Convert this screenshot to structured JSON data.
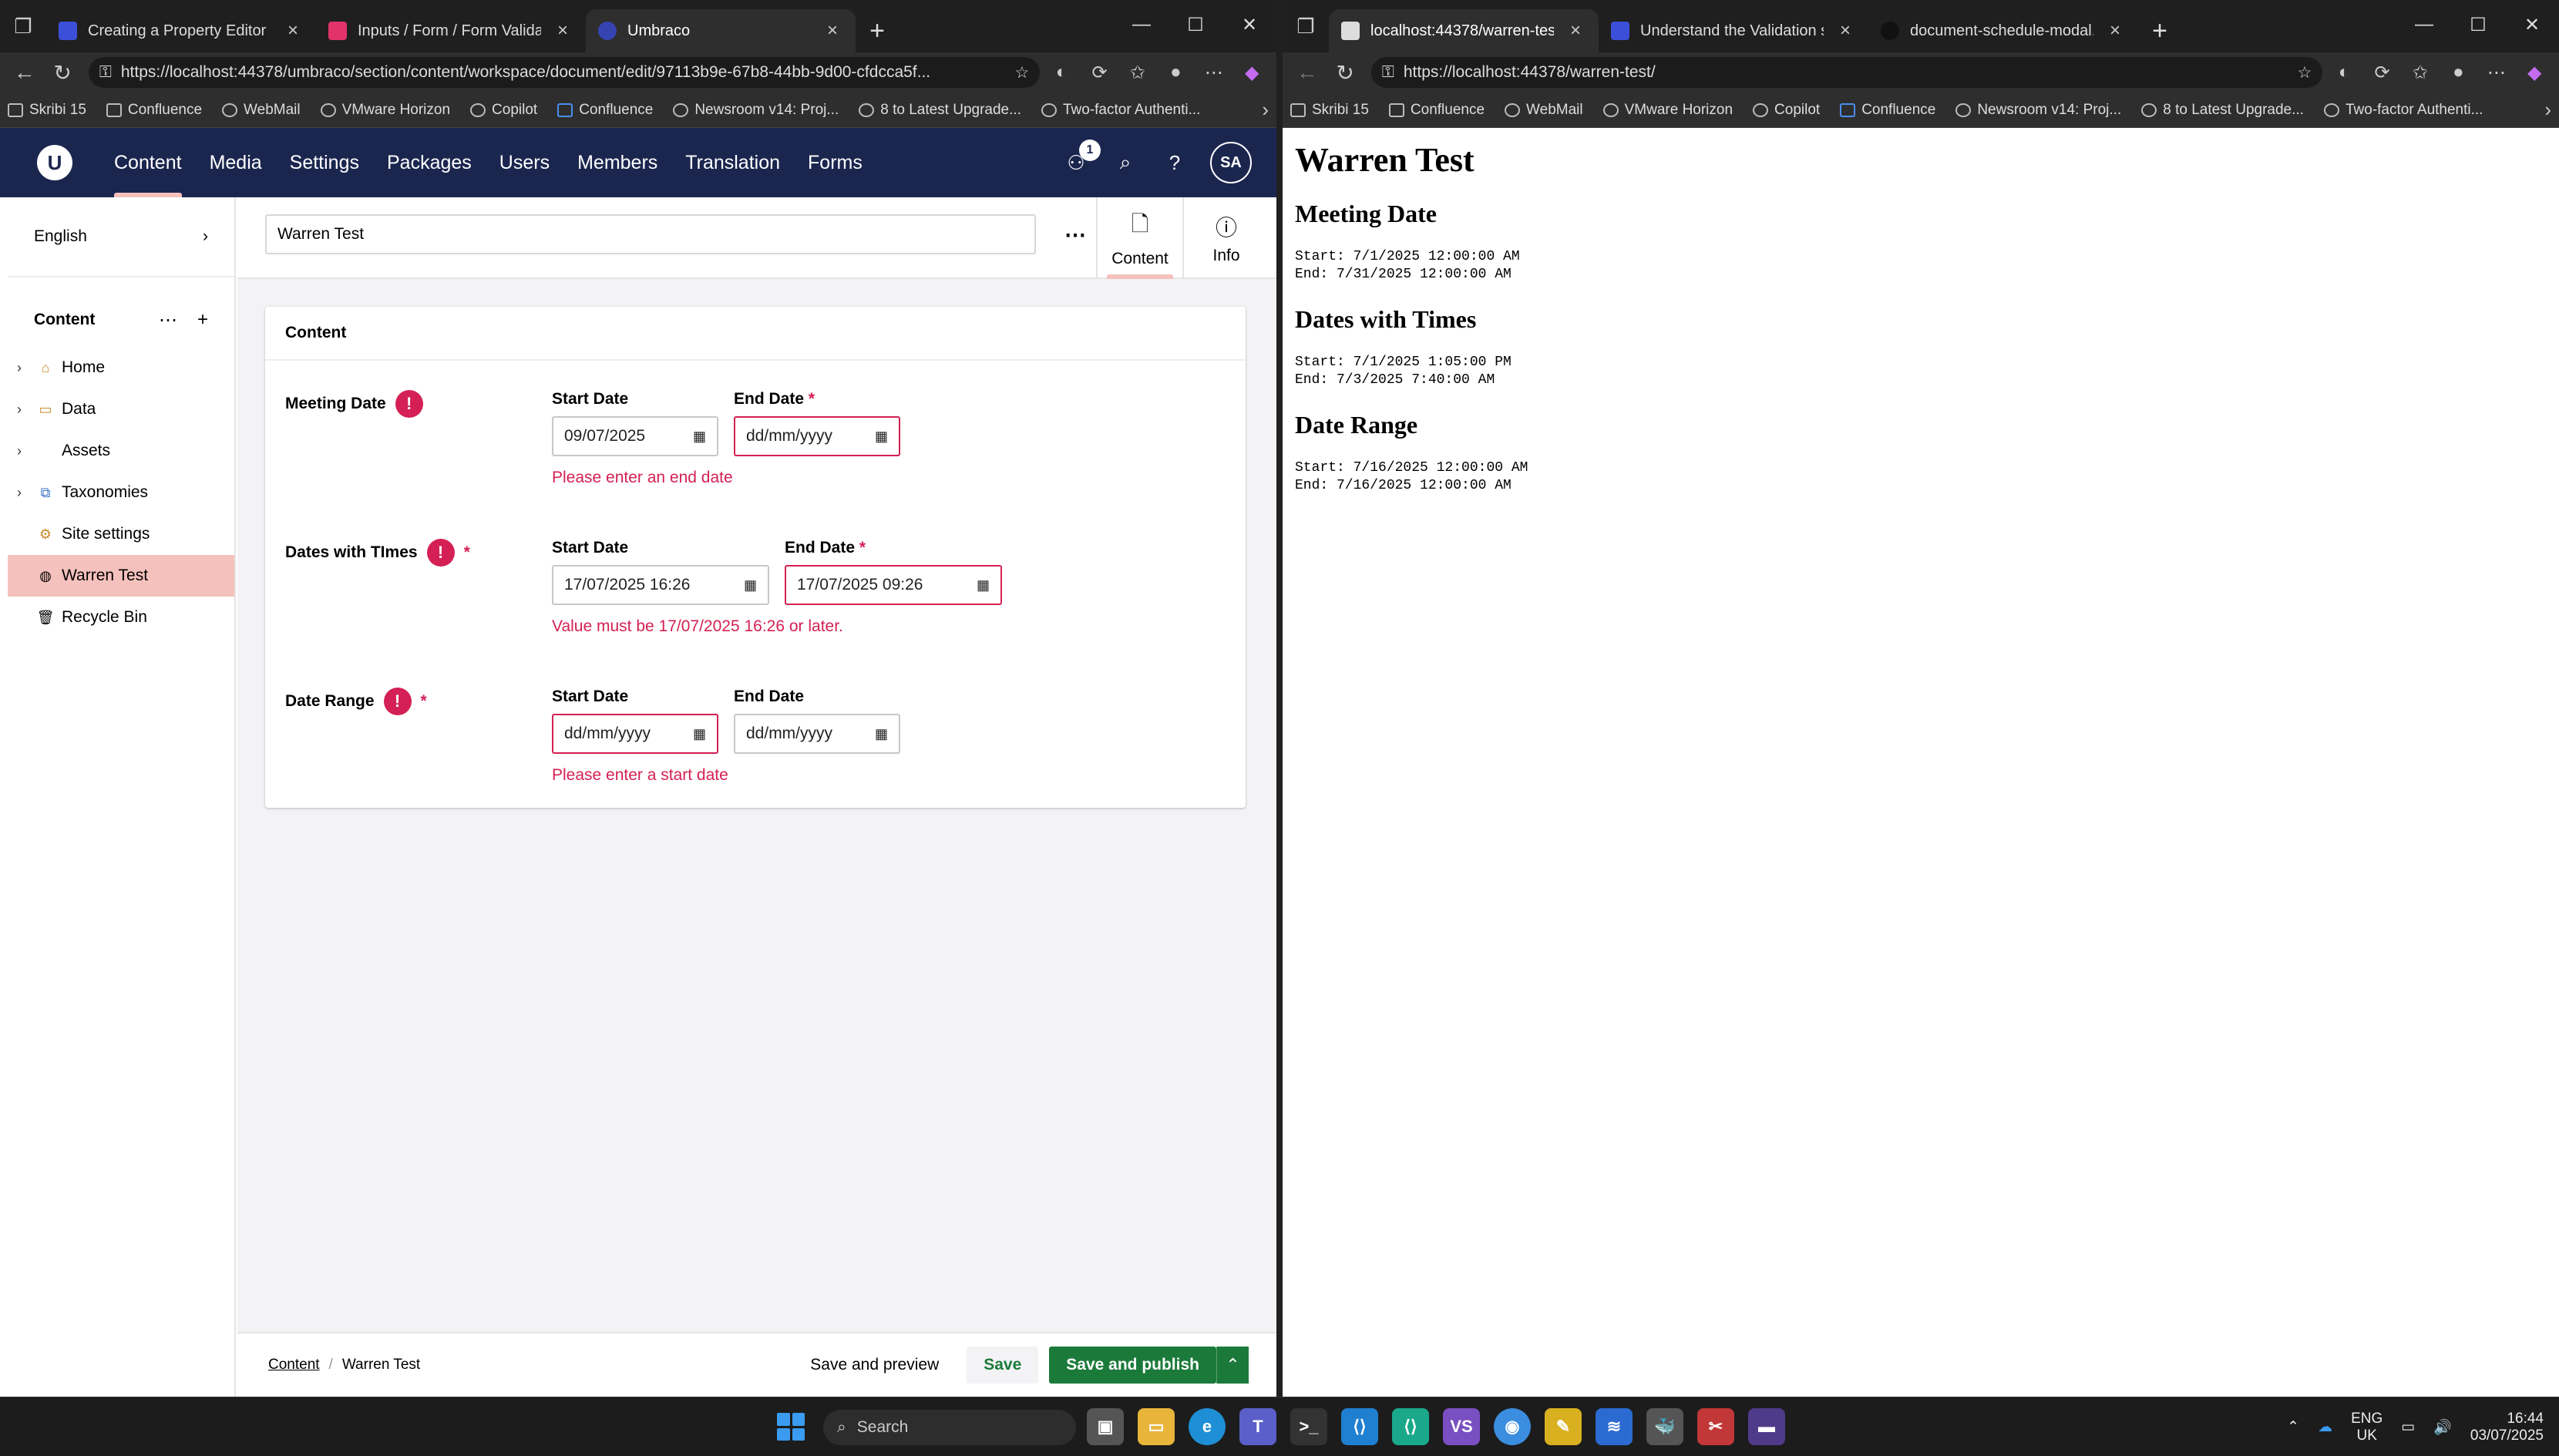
{
  "left_window": {
    "tabs": [
      {
        "title": "Creating a Property Editor | Umbraco",
        "active": false
      },
      {
        "title": "Inputs / Form / Form Validation Messages",
        "active": false
      },
      {
        "title": "Umbraco",
        "active": true
      }
    ],
    "url": "https://localhost:44378/umbraco/section/content/workspace/document/edit/97113b9e-67b8-44bb-9d00-cfdcca5f...",
    "bookmarks": [
      "Skribi 15",
      "Confluence",
      "WebMail",
      "VMware Horizon",
      "Copilot",
      "Confluence",
      "Newsroom v14: Proj...",
      "8 to Latest Upgrade...",
      "Two-factor Authenti..."
    ]
  },
  "right_window": {
    "tabs": [
      {
        "title": "localhost:44378/warren-test/",
        "active": true
      },
      {
        "title": "Understand the Validation system",
        "active": false
      },
      {
        "title": "document-schedule-modal.element.ts",
        "active": false
      }
    ],
    "url": "https://localhost:44378/warren-test/",
    "bookmarks": [
      "Skribi 15",
      "Confluence",
      "WebMail",
      "VMware Horizon",
      "Copilot",
      "Confluence",
      "Newsroom v14: Proj...",
      "8 to Latest Upgrade...",
      "Two-factor Authenti..."
    ]
  },
  "umbraco": {
    "logo": "U",
    "nav": [
      "Content",
      "Media",
      "Settings",
      "Packages",
      "Users",
      "Members",
      "Translation",
      "Forms"
    ],
    "active_nav": "Content",
    "notification_count": "1",
    "avatar": "SA",
    "culture": "English",
    "tree_title": "Content",
    "tree": [
      "Home",
      "Data",
      "Assets",
      "Taxonomies",
      "Site settings",
      "Warren Test",
      "Recycle Bin"
    ],
    "selected_tree_item": "Warren Test",
    "document_name": "Warren Test",
    "views": [
      "Content",
      "Info"
    ],
    "group_title": "Content",
    "properties": [
      {
        "label": "Meeting Date",
        "required": false,
        "start_label": "Start Date",
        "start_value": "09/07/2025",
        "start_error": false,
        "end_label": "End Date",
        "end_required": true,
        "end_value": "dd/mm/yyyy",
        "end_error": true,
        "message": "Please enter an end date"
      },
      {
        "label": "Dates with TImes",
        "required": true,
        "start_label": "Start Date",
        "start_value": "17/07/2025 16:26",
        "start_error": false,
        "end_label": "End Date",
        "end_required": true,
        "end_value": "17/07/2025 09:26",
        "end_error": true,
        "message": "Value must be 17/07/2025 16:26 or later."
      },
      {
        "label": "Date Range",
        "required": true,
        "start_label": "Start Date",
        "start_value": "dd/mm/yyyy",
        "start_error": true,
        "end_label": "End Date",
        "end_required": false,
        "end_value": "dd/mm/yyyy",
        "end_error": false,
        "message": "Please enter a start date"
      }
    ],
    "breadcrumb": [
      "Content",
      "Warren Test"
    ],
    "buttons": {
      "preview": "Save and preview",
      "save": "Save",
      "publish": "Save and publish"
    }
  },
  "preview_page": {
    "title": "Warren Test",
    "sections": [
      {
        "heading": "Meeting Date",
        "lines": [
          "Start: 7/1/2025 12:00:00 AM",
          "End: 7/31/2025 12:00:00 AM"
        ]
      },
      {
        "heading": "Dates with Times",
        "lines": [
          "Start: 7/1/2025 1:05:00 PM",
          "End: 7/3/2025 7:40:00 AM"
        ]
      },
      {
        "heading": "Date Range",
        "lines": [
          "Start: 7/16/2025 12:00:00 AM",
          "End: 7/16/2025 12:00:00 AM"
        ]
      }
    ]
  },
  "taskbar": {
    "search_label": "Search",
    "lang_top": "ENG",
    "lang_bottom": "UK",
    "time": "16:44",
    "date": "03/07/2025"
  },
  "colors": {
    "header": "#1b264f",
    "accent": "#f5c1bc",
    "error": "#d42054",
    "positive": "#1b7a3a"
  }
}
